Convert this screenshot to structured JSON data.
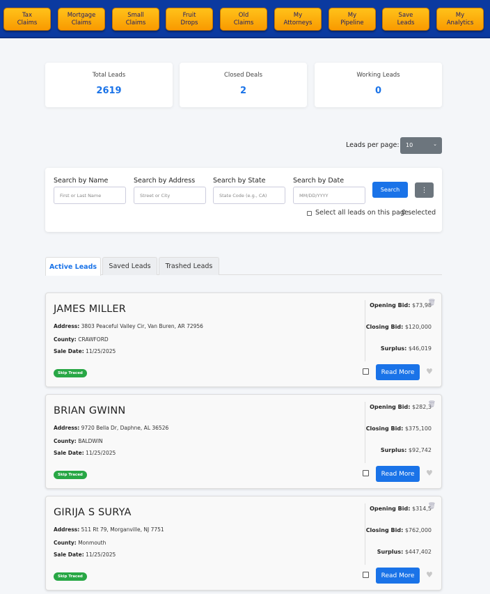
{
  "nav": [
    {
      "label": "Tax\nClaims",
      "name": "nav-tax-claims"
    },
    {
      "label": "Mortgage\nClaims",
      "name": "nav-mortgage-claims"
    },
    {
      "label": "Small\nClaims",
      "name": "nav-small-claims"
    },
    {
      "label": "Fruit\nDrops",
      "name": "nav-fruit-drops"
    },
    {
      "label": "Old\nClaims",
      "name": "nav-old-claims"
    },
    {
      "label": "My\nAttorneys",
      "name": "nav-my-attorneys"
    },
    {
      "label": "My\nPipeline",
      "name": "nav-my-pipeline"
    },
    {
      "label": "Save\nLeads",
      "name": "nav-save-leads"
    },
    {
      "label": "My\nAnalytics",
      "name": "nav-my-analytics"
    }
  ],
  "stats": {
    "total": {
      "label": "Total Leads",
      "value": "2619"
    },
    "closed": {
      "label": "Closed Deals",
      "value": "2"
    },
    "working": {
      "label": "Working Leads",
      "value": "0"
    }
  },
  "per_page": {
    "label": "Leads per page:",
    "value": "10"
  },
  "search": {
    "name_label": "Search by Name",
    "name_placeholder": "First or Last Name",
    "address_label": "Search by Address",
    "address_placeholder": "Street or City",
    "state_label": "Search by State",
    "state_placeholder": "State Code (e.g., CA)",
    "date_label": "Search by Date",
    "date_placeholder": "MM/DD/YYYY",
    "search_button": "Search",
    "more_button": "⋮",
    "select_all_label": "Select all leads on this page",
    "selected_count": "0 selected"
  },
  "tabs": [
    "Active Leads",
    "Saved Leads",
    "Trashed Leads"
  ],
  "field_labels": {
    "address": "Address:",
    "county": "County:",
    "sale_date": "Sale Date:",
    "opening_bid": "Opening Bid:",
    "closing_bid": "Closing Bid:",
    "surplus": "Surplus:"
  },
  "leads": [
    {
      "name": "JAMES MILLER",
      "address": "3803 Peaceful Valley Cir, Van Buren, AR 72956",
      "county": "CRAWFORD",
      "sale_date": "11/25/2025",
      "badge": "Skip Traced",
      "opening_bid": "$73,98",
      "closing_bid": "$120,000",
      "surplus": "$46,019",
      "read_more": "Read More"
    },
    {
      "name": "BRIAN GWINN",
      "address": "9720 Bella Dr, Daphne, AL 36526",
      "county": "BALDWIN",
      "sale_date": "11/25/2025",
      "badge": "Skip Traced",
      "opening_bid": "$282,3",
      "closing_bid": "$375,100",
      "surplus": "$92,742",
      "read_more": "Read More"
    },
    {
      "name": "GIRIJA S SURYA",
      "address": "511 Rt 79, Morganville, NJ 7751",
      "county": "Monmouth",
      "sale_date": "11/25/2025",
      "badge": "Skip Traced",
      "opening_bid": "$314,5",
      "closing_bid": "$762,000",
      "surplus": "$447,402",
      "read_more": "Read More"
    }
  ],
  "colors": {
    "nav_bg": "#0b3aa0",
    "nav_button": "#ffb000",
    "accent": "#1a73e8",
    "badge_green": "#28a745"
  }
}
